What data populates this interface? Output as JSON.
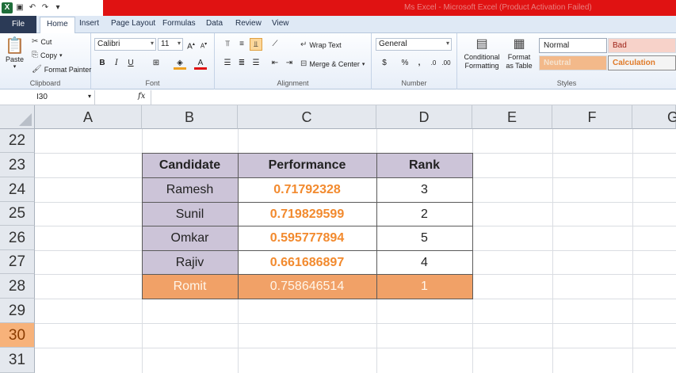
{
  "window": {
    "title": "Ms Excel - Microsoft Excel (Product Activation Failed)",
    "app_icon": "excel-icon"
  },
  "tabs": {
    "file": "File",
    "items": [
      "Home",
      "Insert",
      "Page Layout",
      "Formulas",
      "Data",
      "Review",
      "View"
    ],
    "active": "Home"
  },
  "ribbon": {
    "clipboard": {
      "label": "Clipboard",
      "paste": "Paste",
      "cut": "Cut",
      "copy": "Copy",
      "format_painter": "Format Painter"
    },
    "font": {
      "label": "Font",
      "font_name": "Calibri",
      "font_size": "11",
      "bold": "B",
      "italic": "I",
      "underline": "U"
    },
    "alignment": {
      "label": "Alignment",
      "wrap_text": "Wrap Text",
      "merge_center": "Merge & Center"
    },
    "number": {
      "label": "Number",
      "format": "General",
      "currency": "$",
      "percent": "%",
      "comma": ","
    },
    "styles": {
      "label": "Styles",
      "conditional_formatting": "Conditional Formatting",
      "format_as_table": "Format as Table",
      "normal": "Normal",
      "bad": "Bad",
      "neutral": "Neutral",
      "calculation": "Calculation"
    }
  },
  "formula_bar": {
    "name_box": "I30",
    "fx": "fx",
    "formula": ""
  },
  "sheet": {
    "columns": [
      "A",
      "B",
      "C",
      "D",
      "E",
      "F",
      "G"
    ],
    "rows": [
      "22",
      "23",
      "24",
      "25",
      "26",
      "27",
      "28",
      "29",
      "30",
      "31"
    ],
    "selected_row": "30",
    "table": {
      "headers": [
        "Candidate",
        "Performance",
        "Rank"
      ],
      "rows": [
        [
          "Ramesh",
          "0.71792328",
          "3"
        ],
        [
          "Sunil",
          "0.719829599",
          "2"
        ],
        [
          "Omkar",
          "0.595777894",
          "5"
        ],
        [
          "Rajiv",
          "0.661686897",
          "4"
        ],
        [
          "Romit",
          "0.758646514",
          "1"
        ]
      ]
    }
  },
  "colors": {
    "title_bar": "#e01212",
    "header_fill": "#ccc4d8",
    "performance_text": "#f28a2e",
    "top_row_fill": "#f1a167",
    "selected_row_header": "#f7b27a"
  }
}
